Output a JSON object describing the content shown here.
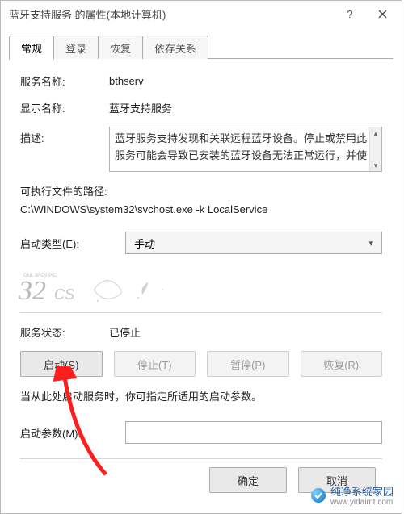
{
  "title": "蓝牙支持服务 的属性(本地计算机)",
  "tabs": [
    "常规",
    "登录",
    "恢复",
    "依存关系"
  ],
  "fields": {
    "serviceNameLabel": "服务名称:",
    "serviceName": "bthserv",
    "displayNameLabel": "显示名称:",
    "displayName": "蓝牙支持服务",
    "descLabel": "描述:",
    "desc": "蓝牙服务支持发现和关联远程蓝牙设备。停止或禁用此服务可能会导致已安装的蓝牙设备无法正常运行，并使",
    "pathLabel": "可执行文件的路径:",
    "path": "C:\\WINDOWS\\system32\\svchost.exe -k LocalService",
    "startupLabel": "启动类型(E):",
    "startupValue": "手动",
    "statusLabel": "服务状态:",
    "statusValue": "已停止",
    "note": "当从此处启动服务时，你可指定所适用的启动参数。",
    "paramLabel": "启动参数(M):"
  },
  "buttons": {
    "start": "启动(S)",
    "stop": "停止(T)",
    "pause": "暂停(P)",
    "resume": "恢复(R)",
    "ok": "确定",
    "cancel": "取消"
  },
  "watermark": {
    "main": "32",
    "suffix": "CS",
    "tag": "ONL 3PCS PIC"
  },
  "brand": {
    "name": "纯净系统家园",
    "url": "www.yidaimt.com"
  }
}
